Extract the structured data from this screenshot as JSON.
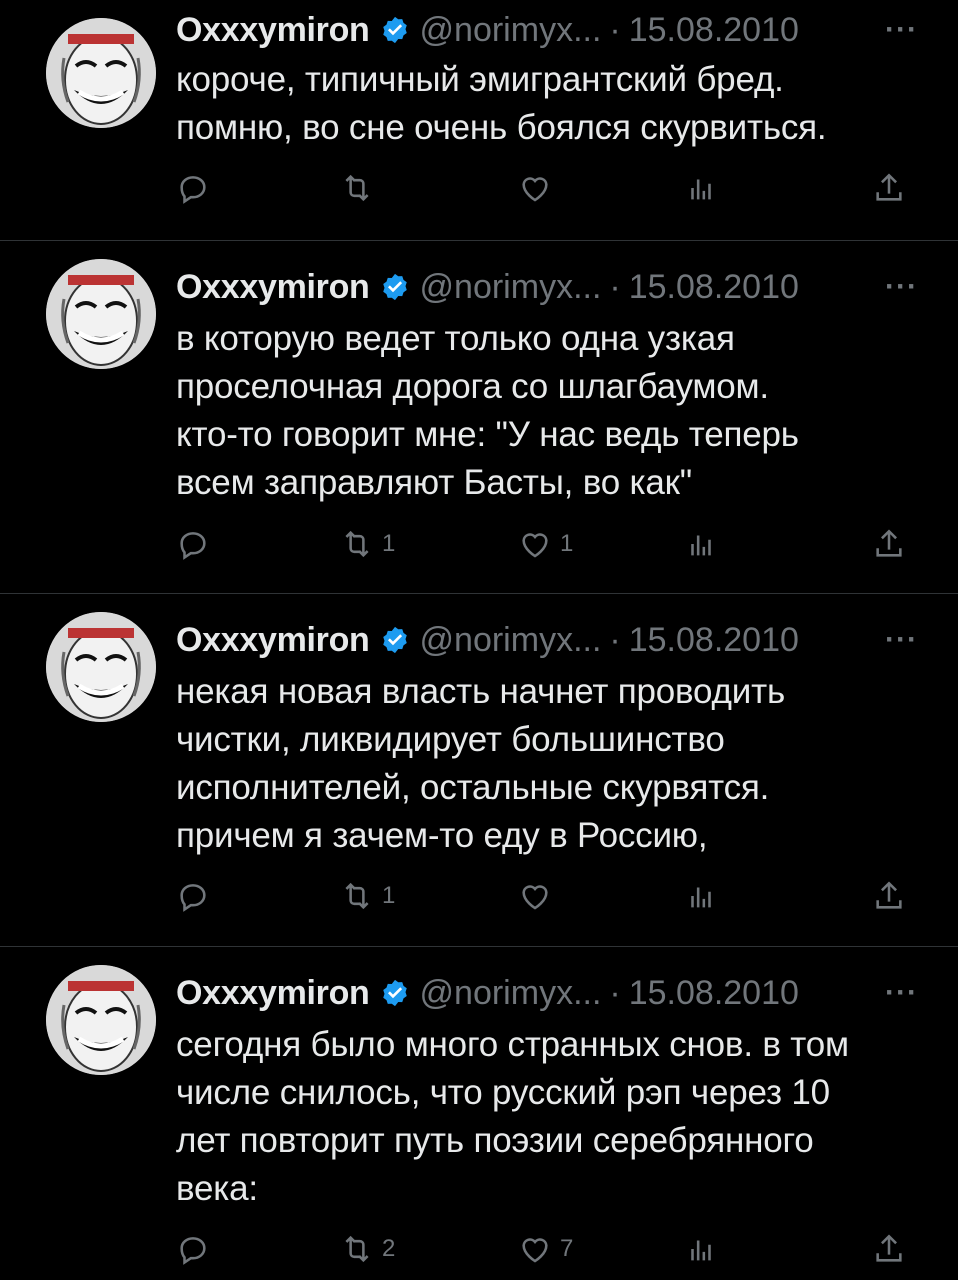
{
  "icons": {
    "verified": "verified-badge-icon",
    "reply": "reply-icon",
    "retweet": "retweet-icon",
    "like": "like-icon",
    "views": "views-icon",
    "share": "share-icon",
    "more": "more-icon"
  },
  "colors": {
    "background": "#000000",
    "text": "#e7e9ea",
    "muted": "#71767b",
    "verified": "#1d9bf0",
    "divider": "#2f3336"
  },
  "tweets": [
    {
      "name": "Oxxxymiron",
      "handle": "@norimyx...",
      "separator": "·",
      "date": "15.08.2010",
      "more": "···",
      "text": "короче, типичный эмигрантский бред.\nпомню, во сне очень боялся скурвиться.",
      "reply_count": "",
      "retweet_count": "",
      "like_count": ""
    },
    {
      "name": "Oxxxymiron",
      "handle": "@norimyx...",
      "separator": "·",
      "date": "15.08.2010",
      "more": "···",
      "text": "в которую ведет только одна узкая\nпроселочная дорога со шлагбаумом.\nкто-то говорит мне: \"У нас ведь теперь\nвсем заправляют Басты, во как\"",
      "reply_count": "",
      "retweet_count": "1",
      "like_count": "1"
    },
    {
      "name": "Oxxxymiron",
      "handle": "@norimyx...",
      "separator": "·",
      "date": "15.08.2010",
      "more": "···",
      "text": "некая новая власть начнет проводить\nчистки, ликвидирует большинство\nисполнителей, остальные скурвятся.\nпричем я зачем-то еду в Россию,",
      "reply_count": "",
      "retweet_count": "1",
      "like_count": ""
    },
    {
      "name": "Oxxxymiron",
      "handle": "@norimyx...",
      "separator": "·",
      "date": "15.08.2010",
      "more": "···",
      "text": "сегодня было много странных снов. в том\nчисле снилось, что русский рэп через 10\nлет повторит путь поэзии серебрянного\nвека:",
      "reply_count": "",
      "retweet_count": "2",
      "like_count": "7"
    }
  ]
}
